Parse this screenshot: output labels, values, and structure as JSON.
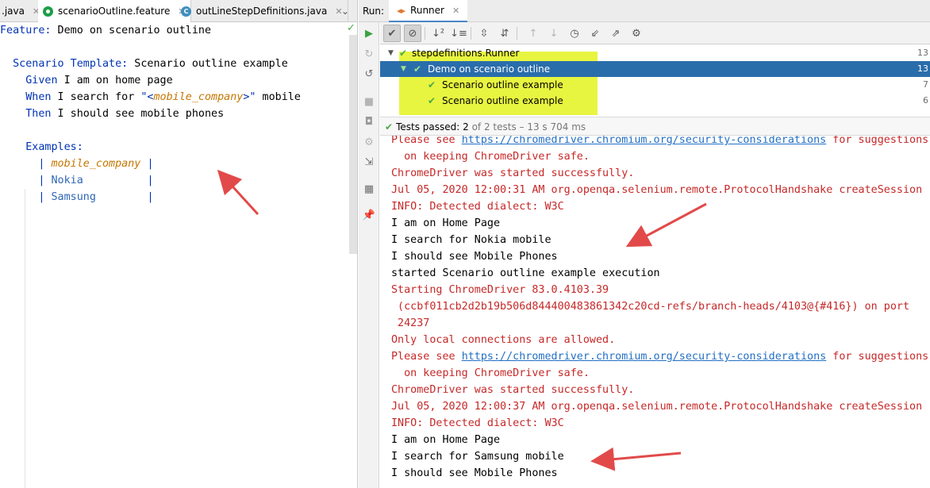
{
  "editor": {
    "tabs": [
      {
        "label": ".java",
        "active": false,
        "icon": "none"
      },
      {
        "label": "scenarioOutline.feature",
        "active": true,
        "icon": "cucumber-icon"
      },
      {
        "label": "outLineStepDefinitions.java",
        "active": false,
        "icon": "java-class-icon"
      }
    ],
    "lines": {
      "l1_kw": "Feature:",
      "l1_text": " Demo on scenario outline",
      "l3_kw": "Scenario Template:",
      "l3_text": " Scenario outline example",
      "l4_kw": "Given",
      "l4_text": " I am on home page",
      "l5_kw": "When",
      "l5_a": " I search for ",
      "l5_q1": "\"<",
      "l5_ph": "mobile_company",
      "l5_q2": ">\"",
      "l5_b": " mobile",
      "l6_kw": "Then",
      "l6_text": " I should see mobile phones",
      "l8_kw": "Examples:",
      "l9_header": "mobile_company",
      "l10_val": "Nokia",
      "l11_val": "Samsung"
    }
  },
  "run": {
    "label": "Run:",
    "tab": "Runner",
    "tree": [
      {
        "name": "stepdefinitions.Runner",
        "duration": "13",
        "level": 0,
        "selected": false
      },
      {
        "name": "Demo on scenario outline",
        "duration": "13",
        "level": 1,
        "selected": true
      },
      {
        "name": "Scenario outline example",
        "duration": "7",
        "level": 2,
        "selected": false
      },
      {
        "name": "Scenario outline example",
        "duration": "6",
        "level": 2,
        "selected": false
      }
    ],
    "status": {
      "prefix": "Tests passed:",
      "count": "2",
      "suffix": "of 2 tests – 13 s 704 ms"
    },
    "console": {
      "l0_a": "Please see ",
      "l0_link": "https://chromedriver.chromium.org/security-considerations",
      "l0_b": " for suggestions",
      "l1": "  on keeping ChromeDriver safe.",
      "l2": "ChromeDriver was started successfully.",
      "l3": "Jul 05, 2020 12:00:31 AM org.openqa.selenium.remote.ProtocolHandshake createSession",
      "l4": "INFO: Detected dialect: W3C",
      "l5": "I am on Home Page",
      "l6": "I search for Nokia mobile",
      "l7": "I should see Mobile Phones",
      "l8": "started Scenario outline example execution",
      "l9": "Starting ChromeDriver 83.0.4103.39",
      "l10": " (ccbf011cb2d2b19b506d844400483861342c20cd-refs/branch-heads/4103@{#416}) on port",
      "l11": " 24237",
      "l12": "Only local connections are allowed.",
      "l13_a": "Please see ",
      "l13_link": "https://chromedriver.chromium.org/security-considerations",
      "l13_b": " for suggestions",
      "l14": "  on keeping ChromeDriver safe.",
      "l15": "ChromeDriver was started successfully.",
      "l16": "Jul 05, 2020 12:00:37 AM org.openqa.selenium.remote.ProtocolHandshake createSession",
      "l17": "INFO: Detected dialect: W3C",
      "l18": "I am on Home Page",
      "l19": "I search for Samsung mobile",
      "l20": "I should see Mobile Phones"
    }
  },
  "colors": {
    "keyword": "#0033b3",
    "placeholder": "#c57600",
    "log_red": "#c62828",
    "link": "#2470c5",
    "highlight": "#e8f540",
    "selection": "#2a6dab",
    "annotation_arrow": "#e24a4a"
  }
}
